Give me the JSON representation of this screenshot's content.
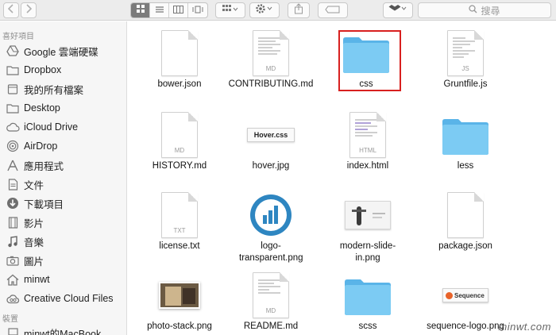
{
  "toolbar": {
    "search_placeholder": "搜尋"
  },
  "sidebar": {
    "favorites_header": "喜好項目",
    "devices_header": "裝置",
    "items": [
      {
        "label": "Google 雲端硬碟",
        "icon": "google-drive-icon"
      },
      {
        "label": "Dropbox",
        "icon": "folder-icon"
      },
      {
        "label": "我的所有檔案",
        "icon": "all-files-icon"
      },
      {
        "label": "Desktop",
        "icon": "folder-icon"
      },
      {
        "label": "iCloud Drive",
        "icon": "cloud-icon"
      },
      {
        "label": "AirDrop",
        "icon": "airdrop-icon"
      },
      {
        "label": "應用程式",
        "icon": "applications-icon"
      },
      {
        "label": "文件",
        "icon": "document-icon"
      },
      {
        "label": "下載項目",
        "icon": "download-icon"
      },
      {
        "label": "影片",
        "icon": "movies-icon"
      },
      {
        "label": "音樂",
        "icon": "music-icon"
      },
      {
        "label": "圖片",
        "icon": "pictures-icon"
      },
      {
        "label": "minwt",
        "icon": "home-icon"
      },
      {
        "label": "Creative Cloud Files",
        "icon": "creative-cloud-icon"
      }
    ],
    "devices": [
      {
        "label": "minwt的MacBook",
        "icon": "laptop-icon"
      }
    ]
  },
  "files": [
    {
      "name": "bower.json",
      "kind": "doc",
      "ext": ""
    },
    {
      "name": "CONTRIBUTING.md",
      "kind": "doc",
      "ext": "MD"
    },
    {
      "name": "css",
      "kind": "folder",
      "ext": ""
    },
    {
      "name": "Gruntfile.js",
      "kind": "doc",
      "ext": "JS"
    },
    {
      "name": "HISTORY.md",
      "kind": "doc",
      "ext": "MD"
    },
    {
      "name": "hover.jpg",
      "kind": "image",
      "ext": "Hover.css"
    },
    {
      "name": "index.html",
      "kind": "doc",
      "ext": "HTML"
    },
    {
      "name": "less",
      "kind": "folder",
      "ext": ""
    },
    {
      "name": "license.txt",
      "kind": "doc",
      "ext": "TXT"
    },
    {
      "name": "logo-transparent.png",
      "kind": "logo",
      "ext": ""
    },
    {
      "name": "modern-slide-in.png",
      "kind": "image",
      "ext": ""
    },
    {
      "name": "package.json",
      "kind": "doc",
      "ext": ""
    },
    {
      "name": "photo-stack.png",
      "kind": "image",
      "ext": ""
    },
    {
      "name": "README.md",
      "kind": "doc",
      "ext": "MD"
    },
    {
      "name": "scss",
      "kind": "folder",
      "ext": ""
    },
    {
      "name": "sequence-logo.png",
      "kind": "image",
      "ext": "Sequence"
    }
  ],
  "watermark": "minwt.com",
  "colors": {
    "folder_blue": "#6cc2f0",
    "highlight_red": "#d8201f",
    "sequence_orange": "#e8632a"
  }
}
